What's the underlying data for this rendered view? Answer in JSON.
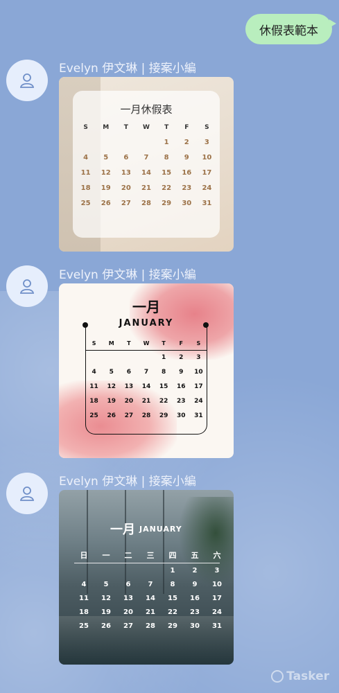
{
  "my_message": "休假表範本",
  "sender_name": "Evelyn 伊文琳 | 接案小編",
  "weekday_letters": [
    "S",
    "M",
    "T",
    "W",
    "T",
    "F",
    "S"
  ],
  "weekday_chinese": [
    "日",
    "一",
    "二",
    "三",
    "四",
    "五",
    "六"
  ],
  "calendar_days": [
    "",
    "",
    "",
    "",
    "1",
    "2",
    "3",
    "4",
    "5",
    "6",
    "7",
    "8",
    "9",
    "10",
    "11",
    "12",
    "13",
    "14",
    "15",
    "16",
    "17",
    "18",
    "19",
    "20",
    "21",
    "22",
    "23",
    "24",
    "25",
    "26",
    "27",
    "28",
    "29",
    "30",
    "31"
  ],
  "card1": {
    "title": "一月休假表"
  },
  "card2": {
    "title": "一月",
    "subtitle": "JANUARY"
  },
  "card3": {
    "title": "一月",
    "subtitle": "JANUARY"
  },
  "watermark": "Tasker",
  "icons": {
    "avatar": "user-icon",
    "watermark": "tasker-logo-icon"
  },
  "colors": {
    "background": "#8aa7d6",
    "my_bubble": "#b9eebe",
    "card1_day": "#9c7248"
  }
}
